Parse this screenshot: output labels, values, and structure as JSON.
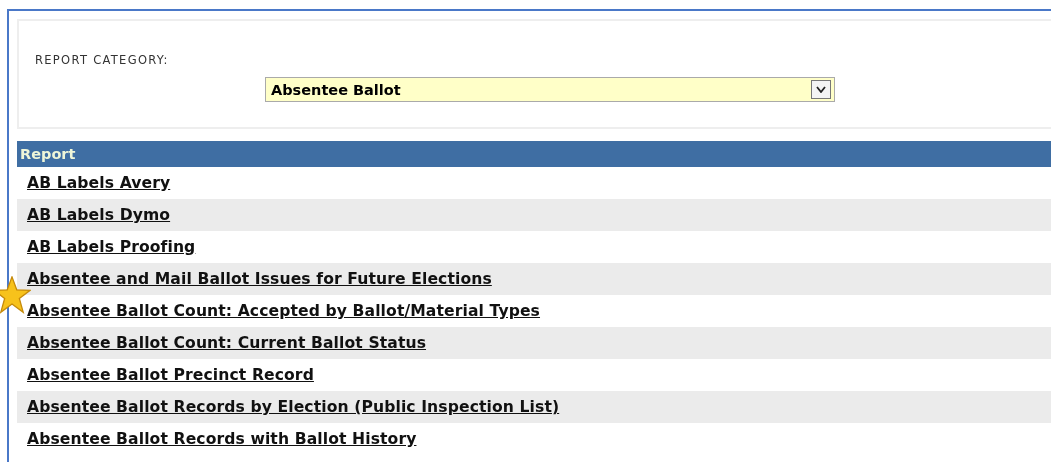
{
  "filter": {
    "label": "REPORT CATEGORY:",
    "value": "Absentee Ballot"
  },
  "table": {
    "columns": [
      "Report"
    ],
    "rows": [
      {
        "name": "AB Labels Avery"
      },
      {
        "name": "AB Labels Dymo"
      },
      {
        "name": "AB Labels Proofing"
      },
      {
        "name": "Absentee and Mail Ballot Issues for Future Elections"
      },
      {
        "name": "Absentee Ballot Count: Accepted by Ballot/Material Types",
        "starred": true
      },
      {
        "name": "Absentee Ballot Count: Current Ballot Status"
      },
      {
        "name": "Absentee Ballot Precinct Record"
      },
      {
        "name": "Absentee Ballot Records by Election (Public Inspection List)"
      },
      {
        "name": "Absentee Ballot Records with Ballot History"
      }
    ]
  }
}
